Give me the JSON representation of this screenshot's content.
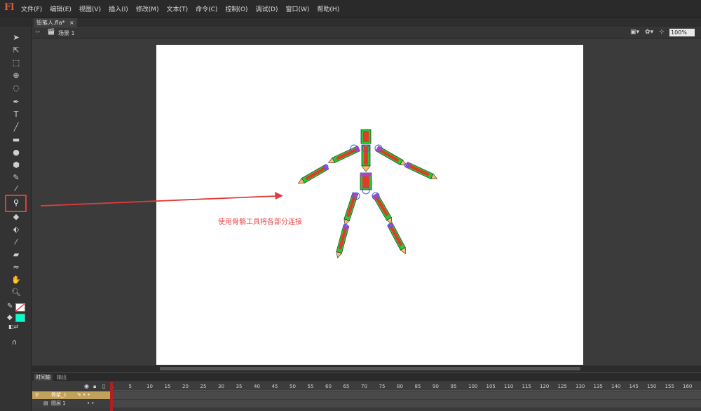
{
  "app": {
    "logo": "Fl"
  },
  "menu": [
    "文件(F)",
    "编辑(E)",
    "视图(V)",
    "插入(I)",
    "修改(M)",
    "文本(T)",
    "命令(C)",
    "控制(O)",
    "调试(D)",
    "窗口(W)",
    "帮助(H)"
  ],
  "document": {
    "tab_label": "铅笔人.fla*",
    "close_glyph": "×"
  },
  "scene": {
    "label": "场景 1",
    "zoom": "100%"
  },
  "annotation": "使用骨骼工具将各部分连接",
  "timeline": {
    "tabs": [
      "时间轴",
      "输出"
    ],
    "frame_ticks": [
      "1",
      "5",
      "10",
      "15",
      "20",
      "25",
      "30",
      "35",
      "40",
      "45",
      "50",
      "55",
      "60",
      "65",
      "70",
      "75",
      "80",
      "85",
      "90",
      "95",
      "100",
      "105",
      "110",
      "115",
      "120",
      "125",
      "130",
      "135",
      "140",
      "145",
      "150",
      "155",
      "160"
    ],
    "layers": [
      {
        "name": "骨架_1",
        "selected": true
      },
      {
        "name": "图层 1",
        "selected": false
      }
    ]
  },
  "colors": {
    "fill_swatch": "#00ffcc",
    "stroke_swatch": "#ff4444",
    "highlight": "#e03c3c",
    "layer_selected": "#c2a15a"
  },
  "toolbar": {
    "icons": [
      "selection-tool-icon",
      "subselection-tool-icon",
      "free-transform-tool-icon",
      "3d-rotation-tool-icon",
      "lasso-tool-icon",
      "pen-tool-icon",
      "text-tool-icon",
      "line-tool-icon",
      "rectangle-tool-icon",
      "oval-tool-icon",
      "polystar-tool-icon",
      "pencil-tool-icon",
      "brush-tool-icon",
      "bone-tool-icon",
      "paint-bucket-tool-icon",
      "ink-bottle-tool-icon",
      "eyedropper-tool-icon",
      "eraser-tool-icon",
      "width-tool-icon",
      "hand-tool-icon",
      "zoom-tool-icon",
      "stroke-color-icon",
      "fill-color-icon",
      "swap-colors-icon",
      "snap-magnet-icon"
    ]
  }
}
